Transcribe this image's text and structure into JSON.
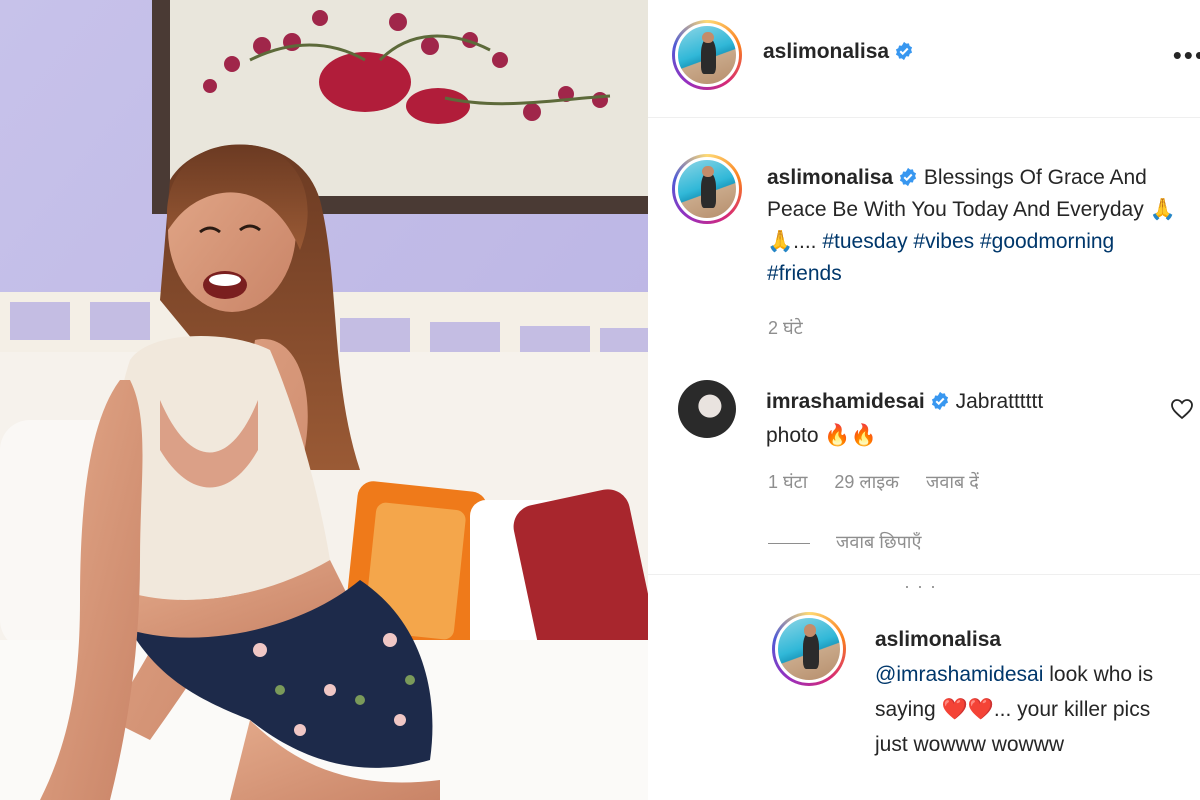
{
  "post": {
    "author": "aslimonalisa",
    "verified": true,
    "more_icon": "more-horizontal-icon"
  },
  "caption": {
    "author": "aslimonalisa",
    "text": "Blessings Of Grace And Peace Be With You Today And Everyday",
    "emoji": "🙏🙏....",
    "hashtags": [
      "#tuesday",
      "#vibes",
      "#goodmorning",
      "#friends"
    ],
    "time": "2 घंटे"
  },
  "comment": {
    "author": "imrashamidesai",
    "verified": true,
    "text": "Jabratttttt photo",
    "emoji": "🔥🔥",
    "time": "1 घंटा",
    "likes": "29 लाइक",
    "reply_label": "जवाब दें",
    "hide_replies_label": "जवाब छिपाएँ"
  },
  "reply": {
    "author": "aslimonalisa",
    "mention": "@imrashamidesai",
    "text_part1": "look who is saying",
    "emoji": "❤️❤️",
    "text_part2": "... your killer pics just wowww wowww"
  },
  "colors": {
    "link": "#00376b",
    "muted": "#8e8e8e",
    "verified": "#3897f0",
    "text": "#262626"
  }
}
